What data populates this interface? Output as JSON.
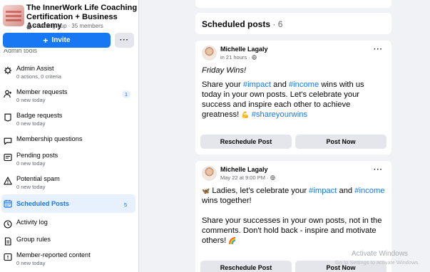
{
  "group": {
    "name": "The InnerWork Life Coaching Certification + Business Academy",
    "privacy": "Private group",
    "separator": "·",
    "members": "35 members"
  },
  "actions": {
    "invite_label": "Invite",
    "more_label": "···"
  },
  "admin_tools": {
    "label": "Admin tools"
  },
  "nav": [
    {
      "label": "Admin Assist",
      "sub": "0 actions, 0 criteria",
      "icon": "gear-check-icon",
      "badge": ""
    },
    {
      "label": "Member requests",
      "sub": "0 new today",
      "icon": "person-add-icon",
      "badge": "1"
    },
    {
      "label": "Badge requests",
      "sub": "0 new today",
      "icon": "badge-icon",
      "badge": ""
    },
    {
      "label": "Membership questions",
      "sub": "",
      "icon": "chat-bubble-icon",
      "badge": ""
    },
    {
      "label": "Pending posts",
      "sub": "0 new today",
      "icon": "pending-posts-icon",
      "badge": ""
    },
    {
      "label": "Potential spam",
      "sub": "0 new today",
      "icon": "warning-icon",
      "badge": ""
    },
    {
      "label": "Scheduled Posts",
      "sub": "",
      "icon": "calendar-icon",
      "badge": "5"
    },
    {
      "label": "Activity log",
      "sub": "",
      "icon": "clock-icon",
      "badge": ""
    },
    {
      "label": "Group rules",
      "sub": "",
      "icon": "rules-icon",
      "badge": ""
    },
    {
      "label": "Member-reported content",
      "sub": "0 new today",
      "icon": "report-icon",
      "badge": ""
    }
  ],
  "scheduled": {
    "title": "Scheduled posts",
    "count": "· 6"
  },
  "posts": [
    {
      "author": "Michelle Lagaly",
      "time": "in 21 hours ·",
      "headline": "Friday Wins!",
      "text_1": "Share your ",
      "tag_1": "#impact",
      "text_2": " and ",
      "tag_2": "#income",
      "text_3": " wins with us today in your own posts. Let's celebrate your success and inspire each other to achieve greatness! ",
      "emoji": "💪",
      "tag_3": "#shareyourwins",
      "reschedule": "Reschedule Post",
      "post_now": "Post Now"
    },
    {
      "author": "Michelle Lagaly",
      "time": "May 22 at 9:00 PM ·",
      "emoji_lead": "🦋",
      "text_1": " Ladies, let's celebrate your ",
      "tag_1": "#impact",
      "text_2": " and ",
      "tag_2": "#income",
      "text_3": " wins together!",
      "text_4": "Share your successes in your own posts, not in the comments. Don't hold back - inspire and motivate others! ",
      "emoji_tail": "🌈",
      "reschedule": "Reschedule Post",
      "post_now": "Post Now"
    }
  ],
  "watermark": {
    "line1": "Activate Windows",
    "line2": "Go to Settings to activate Windows."
  },
  "colors": {
    "accent": "#1877f2",
    "background": "#f0f2f5",
    "button_gray": "#e4e6eb"
  }
}
